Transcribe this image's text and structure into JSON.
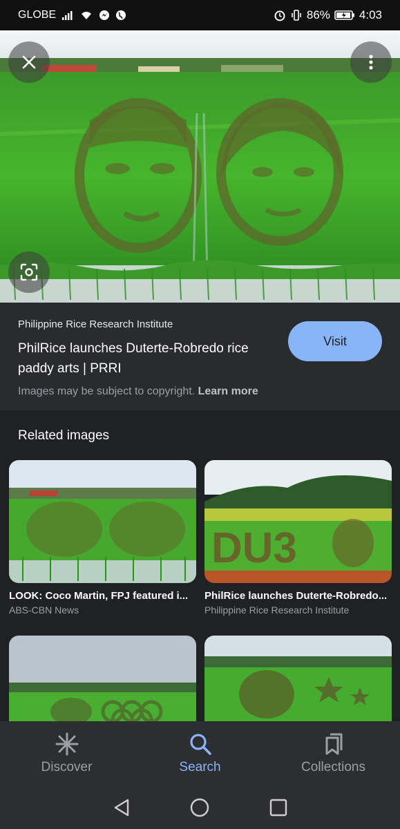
{
  "status_bar": {
    "carrier": "GLOBE",
    "battery": "86%",
    "time": "4:03"
  },
  "image": {
    "source": "Philippine Rice Research Institute",
    "title": "PhilRice launches Duterte-Robredo rice paddy arts | PRRI",
    "visit_label": "Visit",
    "copyright_text": "Images may be subject to copyright.",
    "learn_more": "Learn more"
  },
  "related": {
    "heading": "Related images",
    "items": [
      {
        "title": "LOOK: Coco Martin, FPJ featured i...",
        "source": "ABS-CBN News"
      },
      {
        "title": "PhilRice launches Duterte-Robredo...",
        "source": "Philippine Rice Research Institute"
      },
      {
        "title": "",
        "source": ""
      },
      {
        "title": "",
        "source": ""
      }
    ]
  },
  "bottom_nav": {
    "items": [
      {
        "label": "Discover",
        "icon": "asterisk-icon"
      },
      {
        "label": "Search",
        "icon": "search-icon",
        "active": true
      },
      {
        "label": "Collections",
        "icon": "bookmarks-icon"
      }
    ]
  },
  "colors": {
    "accent": "#8ab4f8",
    "background": "#202124",
    "panel": "#2a2b2f"
  }
}
